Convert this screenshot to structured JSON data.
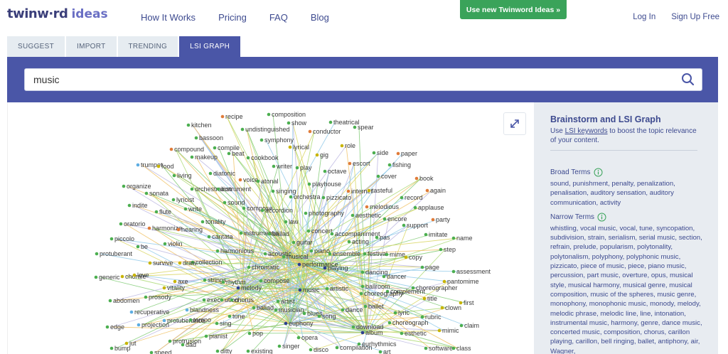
{
  "header": {
    "logo_main": "twinw·rd",
    "logo_sub": "ideas",
    "nav": [
      "How It Works",
      "Pricing",
      "FAQ",
      "Blog"
    ],
    "cta": "Use new Twinword Ideas »",
    "login": "Log In",
    "signup": "Sign Up Free"
  },
  "tabs": [
    {
      "label": "SUGGEST",
      "active": false
    },
    {
      "label": "IMPORT",
      "active": false
    },
    {
      "label": "TRENDING",
      "active": false
    },
    {
      "label": "LSI GRAPH",
      "active": true
    }
  ],
  "search": {
    "value": "music",
    "icon": "search-icon"
  },
  "colors": {
    "accent": "#4a56a7",
    "cta": "#3aa35a",
    "tab_bg": "#e6ecf1",
    "panel_bg": "#e8ecf1",
    "link": "#3d4a8f",
    "node_green": "#4caf50",
    "node_blue": "#5dade2",
    "node_orange": "#e07b39",
    "node_yellow": "#c8b400",
    "node_navy": "#2c3e91"
  },
  "panel": {
    "title": "Brainstorm and LSI Graph",
    "desc_pre": "Use ",
    "desc_link": "LSI keywords",
    "desc_post": " to boost the topic relevance of your content.",
    "broad_title": "Broad Terms",
    "broad_terms": "sound, punishment, penalty, penalization, penalisation, auditory sensation, auditory communication, activity",
    "narrow_title": "Narrow Terms",
    "narrow_terms": "whistling, vocal music, vocal, tune, syncopation, subdivision, strain, serialism, serial music, section, refrain, prelude, popularism, polytonality, polytonalism, polyphony, polyphonic music, pizzicato, piece of music, piece, piano music, percussion, part music, overture, opus, musical style, musical harmony, musical genre, musical composition, music of the spheres, music genre, monophony, monophonic music, monody, melody, melodic phrase, melodic line, line, intonation, instrumental music, harmony, genre, dance music, concerted music, composition, chorus, carillon playing, carillon, bell ringing, ballet, antiphony, air, Wagner,"
  },
  "graph": {
    "expand_icon": "expand-icon",
    "nodes": [
      [
        "composition",
        383,
        161,
        "g"
      ],
      [
        "recipe",
        318,
        164,
        "o"
      ],
      [
        "show",
        411,
        173,
        "g"
      ],
      [
        "theatrical",
        470,
        172,
        "g"
      ],
      [
        "kitchen",
        270,
        176,
        "g"
      ],
      [
        "undistinguished",
        346,
        182,
        "g"
      ],
      [
        "spear",
        504,
        179,
        "g"
      ],
      [
        "conductor",
        441,
        185,
        "o"
      ],
      [
        "bassoon",
        281,
        194,
        "g"
      ],
      [
        "symphony",
        373,
        197,
        "g"
      ],
      [
        "role",
        486,
        205,
        "y"
      ],
      [
        "compound",
        246,
        210,
        "o"
      ],
      [
        "compile",
        307,
        208,
        "g"
      ],
      [
        "lyrical",
        413,
        207,
        "y"
      ],
      [
        "side",
        531,
        215,
        "g"
      ],
      [
        "paper",
        565,
        216,
        "o"
      ],
      [
        "makeup",
        275,
        221,
        "g"
      ],
      [
        "beat",
        327,
        216,
        "g"
      ],
      [
        "gig",
        451,
        218,
        "y"
      ],
      [
        "cookbook",
        354,
        222,
        "g"
      ],
      [
        "escort",
        497,
        230,
        "o"
      ],
      [
        "fishing",
        553,
        232,
        "g"
      ],
      [
        "trumpet",
        199,
        232,
        "b"
      ],
      [
        "food",
        228,
        234,
        "y"
      ],
      [
        "writer",
        390,
        234,
        "g"
      ],
      [
        "play",
        423,
        236,
        "g"
      ],
      [
        "octave",
        462,
        241,
        "g"
      ],
      [
        "diatonic",
        301,
        244,
        "g"
      ],
      [
        "cover",
        537,
        248,
        "g"
      ],
      [
        "book",
        591,
        251,
        "o"
      ],
      [
        "living",
        250,
        247,
        "g"
      ],
      [
        "voice",
        343,
        253,
        "o"
      ],
      [
        "atonal",
        368,
        255,
        "g"
      ],
      [
        "playhouse",
        440,
        259,
        "g"
      ],
      [
        "organize",
        179,
        262,
        "g"
      ],
      [
        "orchestration",
        275,
        266,
        "g"
      ],
      [
        "instrument",
        312,
        266,
        "g"
      ],
      [
        "singing",
        389,
        269,
        "g"
      ],
      [
        "internet",
        495,
        269,
        "o"
      ],
      [
        "tasteful",
        524,
        268,
        "y"
      ],
      [
        "again",
        606,
        268,
        "o"
      ],
      [
        "sonata",
        211,
        272,
        "g"
      ],
      [
        "lyricist",
        249,
        281,
        "g"
      ],
      [
        "orchestra",
        414,
        277,
        "g"
      ],
      [
        "pizzicato",
        460,
        278,
        "g"
      ],
      [
        "record",
        570,
        278,
        "g"
      ],
      [
        "indite",
        187,
        289,
        "g"
      ],
      [
        "sound",
        321,
        285,
        "g"
      ],
      [
        "melodious",
        521,
        291,
        "o"
      ],
      [
        "applause",
        589,
        292,
        "g"
      ],
      [
        "flute",
        225,
        298,
        "g"
      ],
      [
        "write",
        266,
        294,
        "g"
      ],
      [
        "compose",
        348,
        293,
        "g"
      ],
      [
        "accordion",
        374,
        296,
        "g"
      ],
      [
        "photography",
        435,
        300,
        "g"
      ],
      [
        "aesthetic",
        501,
        303,
        "g"
      ],
      [
        "encore",
        546,
        308,
        "g"
      ],
      [
        "party",
        614,
        309,
        "o"
      ],
      [
        "oratorio",
        175,
        315,
        "g"
      ],
      [
        "harmonize",
        215,
        321,
        "o"
      ],
      [
        "tonality",
        290,
        312,
        "g"
      ],
      [
        "law",
        407,
        312,
        "g"
      ],
      [
        "support",
        573,
        317,
        "g"
      ],
      [
        "hearing",
        256,
        323,
        "o"
      ],
      [
        "concert",
        439,
        325,
        "g"
      ],
      [
        "accompaniment",
        472,
        329,
        "g"
      ],
      [
        "imitate",
        604,
        330,
        "g"
      ],
      [
        "name",
        643,
        335,
        "g"
      ],
      [
        "piccolo",
        162,
        336,
        "g"
      ],
      [
        "cantata",
        299,
        333,
        "g"
      ],
      [
        "instrumental",
        344,
        328,
        "g"
      ],
      [
        "ballad",
        384,
        329,
        "g"
      ],
      [
        "pas",
        535,
        334,
        "g"
      ],
      [
        "acting",
        496,
        340,
        "g"
      ],
      [
        "guitar",
        418,
        341,
        "g"
      ],
      [
        "be",
        199,
        347,
        "g"
      ],
      [
        "violin",
        237,
        343,
        "g"
      ],
      [
        "step",
        625,
        351,
        "g"
      ],
      [
        "harmonious",
        311,
        353,
        "g"
      ],
      [
        "piano",
        443,
        353,
        "g"
      ],
      [
        "ensemble",
        469,
        357,
        "g"
      ],
      [
        "protuberant",
        141,
        357,
        "g"
      ],
      [
        "acoustic",
        378,
        357,
        "g"
      ],
      [
        "festival",
        518,
        357,
        "g"
      ],
      [
        "mime",
        549,
        358,
        "g"
      ],
      [
        "copy",
        576,
        362,
        "y"
      ],
      [
        "musical",
        404,
        361,
        "g"
      ],
      [
        "collection",
        276,
        369,
        "g"
      ],
      [
        "survive",
        216,
        370,
        "y"
      ],
      [
        "draw",
        258,
        370,
        "y"
      ],
      [
        "performance",
        426,
        372,
        "n"
      ],
      [
        "playing",
        462,
        377,
        "n"
      ],
      [
        "page",
        599,
        376,
        "g"
      ],
      [
        "assessment",
        643,
        382,
        "g"
      ],
      [
        "chromatic",
        355,
        376,
        "g"
      ],
      [
        "dancing",
        515,
        383,
        "g"
      ],
      [
        "generic",
        140,
        390,
        "g"
      ],
      [
        "chorale",
        177,
        389,
        "y"
      ],
      [
        "love",
        194,
        387,
        "y"
      ],
      [
        "dancer",
        545,
        389,
        "g"
      ],
      [
        "axe",
        251,
        396,
        "y"
      ],
      [
        "strings",
        293,
        394,
        "g"
      ],
      [
        "rhythm",
        319,
        397,
        "g"
      ],
      [
        "compose",
        372,
        395,
        "g"
      ],
      [
        "pantomime",
        630,
        396,
        "y"
      ],
      [
        "vitality",
        236,
        405,
        "y"
      ],
      [
        "melody",
        340,
        405,
        "n"
      ],
      [
        "music",
        427,
        408,
        "n"
      ],
      [
        "artistic",
        465,
        406,
        "g"
      ],
      [
        "ballroom",
        515,
        403,
        "g"
      ],
      [
        "choreographer",
        586,
        405,
        "g"
      ],
      [
        "complement",
        550,
        410,
        "g"
      ],
      [
        "abdomen",
        160,
        423,
        "g"
      ],
      [
        "prosody",
        210,
        418,
        "g"
      ],
      [
        "exec",
        292,
        422,
        "g"
      ],
      [
        "ution",
        317,
        422,
        "g"
      ],
      [
        "chorus",
        331,
        422,
        "g"
      ],
      [
        "choreography",
        513,
        413,
        "g"
      ],
      [
        "title",
        602,
        420,
        "y"
      ],
      [
        "artist",
        396,
        424,
        "g"
      ],
      [
        "first",
        653,
        426,
        "y"
      ],
      [
        "blandness",
        268,
        436,
        "b"
      ],
      [
        "ballad",
        362,
        433,
        "g"
      ],
      [
        "musician",
        393,
        436,
        "g"
      ],
      [
        "ballet",
        519,
        431,
        "g"
      ],
      [
        "clown",
        627,
        433,
        "y"
      ],
      [
        "recuperative",
        190,
        439,
        "b"
      ],
      [
        "blues",
        433,
        441,
        "g"
      ],
      [
        "song",
        454,
        445,
        "g"
      ],
      [
        "dance",
        487,
        436,
        "g"
      ],
      [
        "lyric",
        561,
        440,
        "g"
      ],
      [
        "rubric",
        599,
        446,
        "g"
      ],
      [
        "protuberance",
        236,
        451,
        "b"
      ],
      [
        "tempo",
        273,
        450,
        "g"
      ],
      [
        "tune",
        328,
        445,
        "g"
      ],
      [
        "sing",
        310,
        455,
        "g"
      ],
      [
        "edge",
        156,
        460,
        "g"
      ],
      [
        "projection",
        200,
        457,
        "b"
      ],
      [
        "euphony",
        407,
        455,
        "n"
      ],
      [
        "choreograph",
        553,
        454,
        "g"
      ],
      [
        "download",
        502,
        460,
        "g"
      ],
      [
        "claim",
        654,
        458,
        "g"
      ],
      [
        "pianist",
        295,
        473,
        "g"
      ],
      [
        "pop",
        356,
        469,
        "g"
      ],
      [
        "album",
        515,
        468,
        "n"
      ],
      [
        "esthetic",
        570,
        469,
        "g"
      ],
      [
        "mimic",
        623,
        465,
        "y"
      ],
      [
        "opera",
        425,
        475,
        "g"
      ],
      [
        "jut",
        183,
        483,
        "y"
      ],
      [
        "protrusion",
        244,
        480,
        "g"
      ],
      [
        "bump",
        162,
        490,
        "g"
      ],
      [
        "dad",
        262,
        485,
        "g"
      ],
      [
        "singer",
        398,
        487,
        "g"
      ],
      [
        "eurhythmics",
        510,
        484,
        "g"
      ],
      [
        "speed",
        218,
        496,
        "g"
      ],
      [
        "ditty",
        311,
        494,
        "g"
      ],
      [
        "existing",
        354,
        494,
        "g"
      ],
      [
        "disco",
        442,
        492,
        "g"
      ],
      [
        "compilation",
        479,
        489,
        "g"
      ],
      [
        "art",
        540,
        495,
        "g"
      ],
      [
        "software",
        604,
        490,
        "g"
      ],
      [
        "class",
        643,
        490,
        "g"
      ]
    ]
  }
}
